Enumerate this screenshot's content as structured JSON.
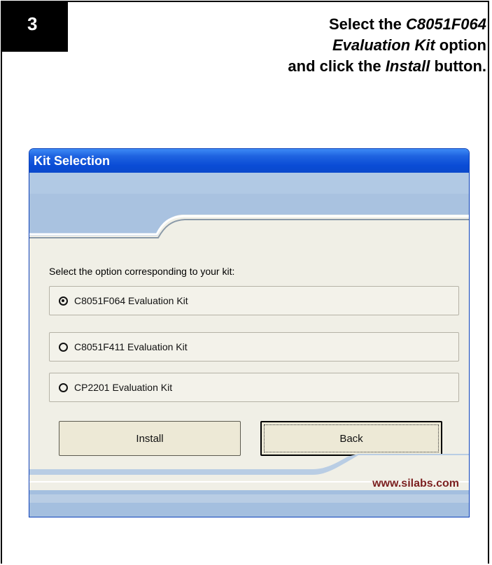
{
  "step": {
    "number": "3",
    "instruction_parts": [
      {
        "text": "Select the ",
        "italic": false
      },
      {
        "text": "C8051F064",
        "italic": true
      },
      {
        "text": " Evaluation Kit",
        "italic": true
      },
      {
        "text": " option",
        "italic": false
      },
      {
        "text": " and click the ",
        "italic": false
      },
      {
        "text": "Install",
        "italic": true
      },
      {
        "text": " button.",
        "italic": false
      }
    ]
  },
  "dialog": {
    "title": "Kit Selection",
    "prompt": "Select the option corresponding to your kit:",
    "options": [
      {
        "label": "C8051F064 Evaluation Kit",
        "selected": true
      },
      {
        "label": "C8051F411 Evaluation Kit",
        "selected": false
      },
      {
        "label": "CP2201 Evaluation Kit",
        "selected": false
      }
    ],
    "install_label": "Install",
    "back_label": "Back",
    "footer_url": "www.silabs.com"
  },
  "colors": {
    "titlebar": "#0a4cd6",
    "banner": "#a9c2e0",
    "url": "#7b1f1f"
  }
}
